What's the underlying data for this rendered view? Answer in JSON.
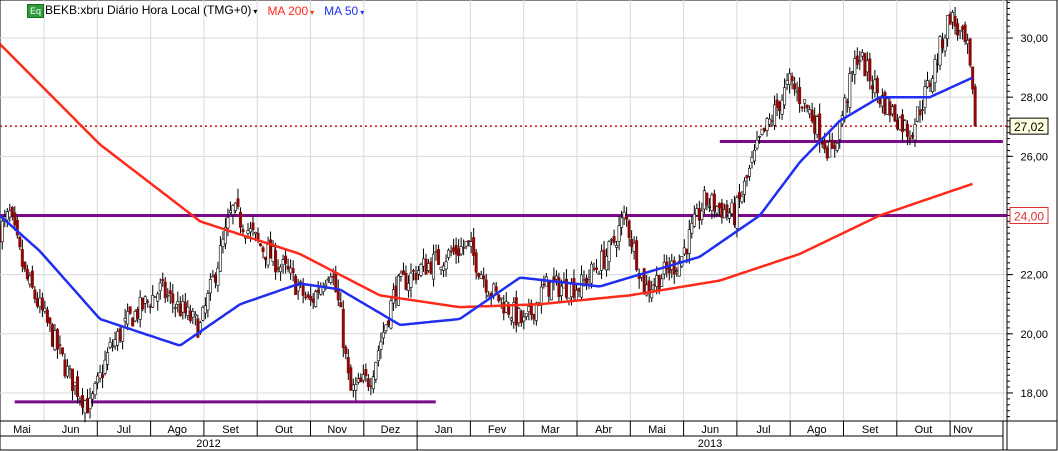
{
  "header": {
    "badge": "Eq",
    "symbol": "BEKB:xbru Diário Hora Local (TMG+0)",
    "ma200_label": "MA 200",
    "ma50_label": "MA 50",
    "dropdown_glyph": "▾"
  },
  "colors": {
    "ma200": "#ff2a1a",
    "ma50": "#1f2ef0",
    "support": "#7a0a8a",
    "last": "#c01010",
    "grid": "#d8d8d8",
    "down": "#8a0a0a",
    "up": "#ffffff"
  },
  "chart_data": {
    "type": "candlestick",
    "title": "BEKB:xbru Diário Hora Local (TMG+0)",
    "x_unit": "months since 1 May 2012",
    "ylim": [
      17.2,
      31.3
    ],
    "y_ticks": [
      "18,00",
      "20,00",
      "22,00",
      "24,00",
      "26,00",
      "28,00",
      "30,00"
    ],
    "y_tick_values": [
      18,
      20,
      22,
      24,
      26,
      28,
      30
    ],
    "month_labels": [
      "Mai",
      "Jun",
      "Jul",
      "Ago",
      "Set",
      "Out",
      "Nov",
      "Dez",
      "Jan",
      "Fev",
      "Mar",
      "Abr",
      "Mai",
      "Jun",
      "Jul",
      "Ago",
      "Set",
      "Out",
      "Nov"
    ],
    "year_labels": [
      "2012",
      "2013"
    ],
    "price_path": [
      [
        0.17,
        23.5
      ],
      [
        0.36,
        24
      ],
      [
        0.64,
        22
      ],
      [
        1.02,
        20.5
      ],
      [
        1.49,
        18.5
      ],
      [
        1.86,
        17.5
      ],
      [
        2.24,
        19.5
      ],
      [
        2.61,
        20.5
      ],
      [
        3.18,
        21.5
      ],
      [
        3.93,
        20.2
      ],
      [
        4.53,
        24.2
      ],
      [
        5.05,
        23
      ],
      [
        5.6,
        22
      ],
      [
        5.99,
        21
      ],
      [
        6.37,
        22.3
      ],
      [
        6.55,
        20.8
      ],
      [
        6.74,
        18
      ],
      [
        7.12,
        18.5
      ],
      [
        7.59,
        21.5
      ],
      [
        8.05,
        22.2
      ],
      [
        8.95,
        23
      ],
      [
        9.37,
        21.5
      ],
      [
        10.02,
        20.3
      ],
      [
        10.4,
        21.6
      ],
      [
        11.06,
        21.6
      ],
      [
        11.62,
        22.8
      ],
      [
        11.9,
        24
      ],
      [
        12.28,
        21.5
      ],
      [
        12.93,
        22.5
      ],
      [
        13.4,
        24.5
      ],
      [
        13.96,
        24
      ],
      [
        14.43,
        26.5
      ],
      [
        14.99,
        28.5
      ],
      [
        15.37,
        27.5
      ],
      [
        15.78,
        26
      ],
      [
        16.27,
        29.5
      ],
      [
        16.68,
        28
      ],
      [
        17.25,
        26.8
      ],
      [
        17.62,
        28.5
      ],
      [
        18,
        30.8
      ],
      [
        18.34,
        29.5
      ],
      [
        18.47,
        27.02
      ]
    ],
    "ma200": [
      [
        0.17,
        29.8
      ],
      [
        2.05,
        26.4
      ],
      [
        3.93,
        23.8
      ],
      [
        5.8,
        22.7
      ],
      [
        7.3,
        21.3
      ],
      [
        8.8,
        20.9
      ],
      [
        10.3,
        21
      ],
      [
        11.99,
        21.3
      ],
      [
        13.68,
        21.8
      ],
      [
        15.18,
        22.7
      ],
      [
        16.68,
        24
      ],
      [
        18.47,
        25.1
      ]
    ],
    "ma50": [
      [
        0.17,
        24
      ],
      [
        0.92,
        22.8
      ],
      [
        2.05,
        20.5
      ],
      [
        3.55,
        19.6
      ],
      [
        4.68,
        21
      ],
      [
        5.8,
        21.7
      ],
      [
        6.55,
        21.5
      ],
      [
        7.68,
        20.3
      ],
      [
        8.8,
        20.5
      ],
      [
        9.93,
        21.9
      ],
      [
        11.43,
        21.6
      ],
      [
        12.17,
        22
      ],
      [
        13.3,
        22.6
      ],
      [
        14.43,
        24
      ],
      [
        15.18,
        25.8
      ],
      [
        15.93,
        27.2
      ],
      [
        16.68,
        28
      ],
      [
        17.62,
        28
      ],
      [
        18.47,
        28.7
      ]
    ],
    "horizontal_lines": [
      {
        "value": 24.0,
        "from": 0,
        "to": 19.1,
        "label": "24,00"
      },
      {
        "value": 17.7,
        "from": 0.45,
        "to": 8.35
      },
      {
        "value": 26.5,
        "from": 13.68,
        "to": 18.99
      }
    ],
    "last_price": {
      "value": 27.02,
      "label": "27,02"
    }
  }
}
